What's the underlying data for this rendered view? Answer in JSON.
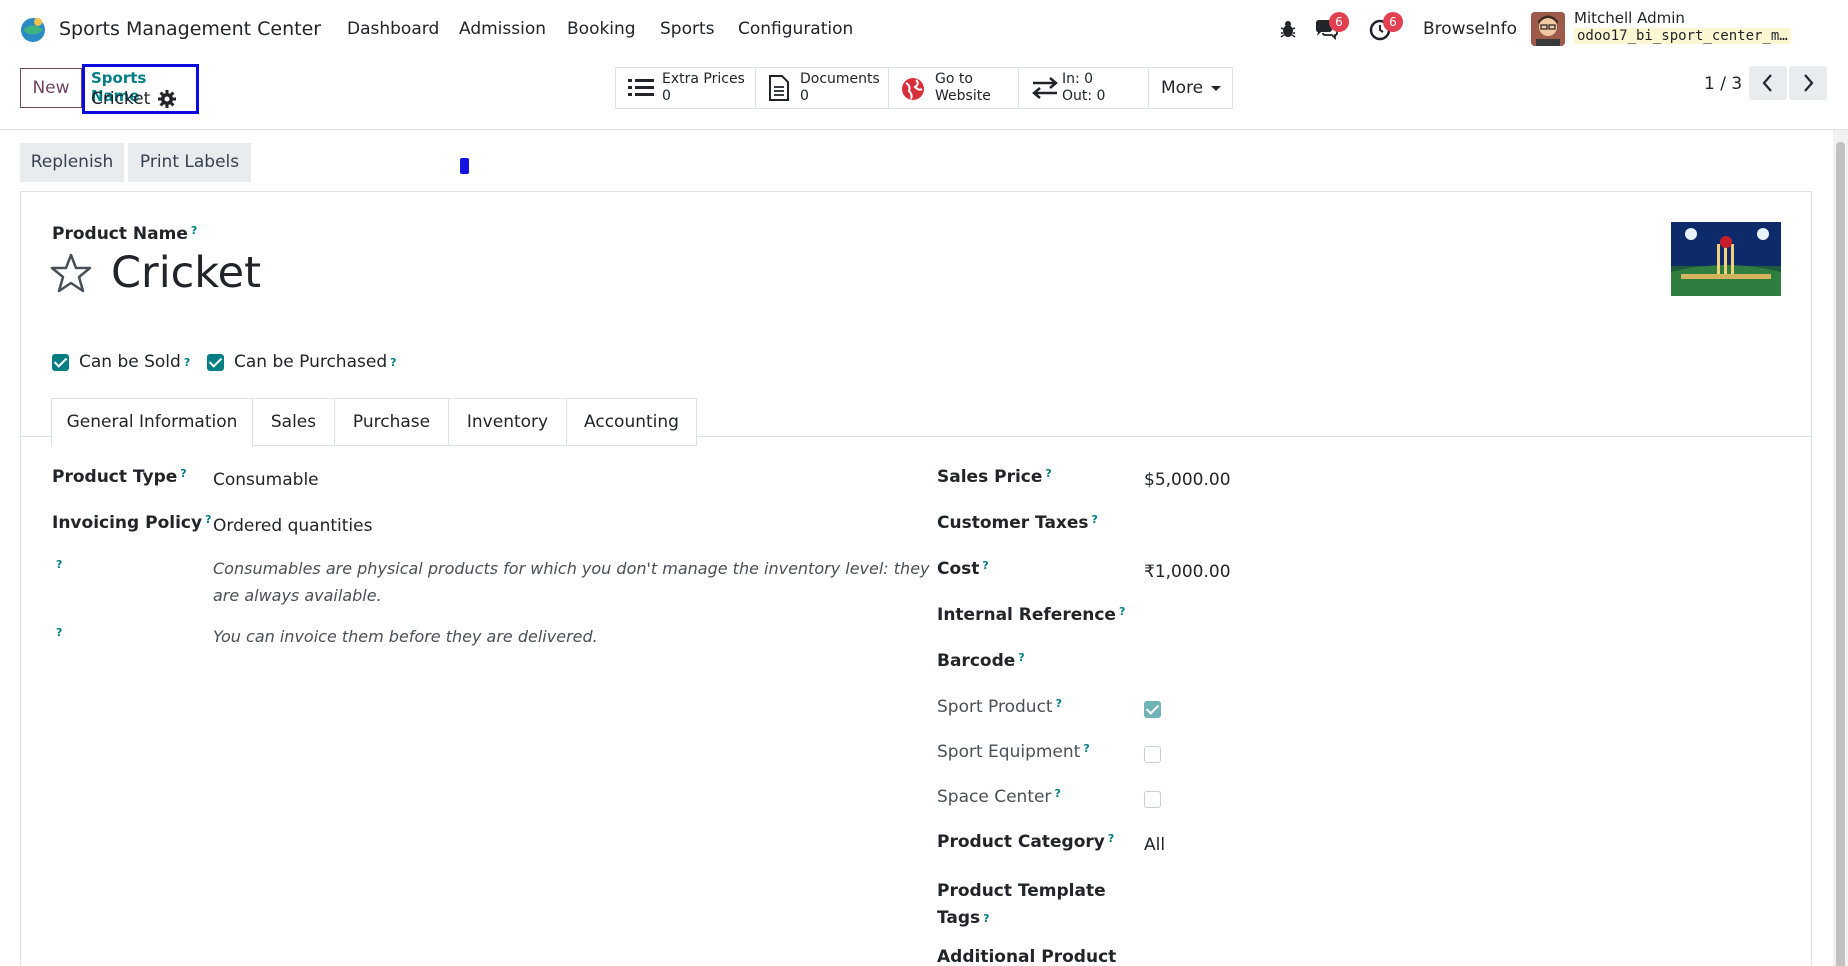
{
  "navbar": {
    "app_title": "Sports Management Center",
    "menu": [
      "Dashboard",
      "Admission",
      "Booking",
      "Sports",
      "Configuration"
    ],
    "messages_count": "6",
    "activities_count": "6",
    "company": "BrowseInfo",
    "user_name": "Mitchell Admin",
    "database": "odoo17_bi_sport_center_m…"
  },
  "control": {
    "new_label": "New",
    "breadcrumb_parent": "Sports Name",
    "breadcrumb_current": "Cricket",
    "smart_buttons": [
      {
        "label": "Extra Prices",
        "value": "0"
      },
      {
        "label": "Documents",
        "value": "0"
      },
      {
        "label": "Go to",
        "value": "Website"
      },
      {
        "label": "In: 0",
        "value": "Out: 0"
      }
    ],
    "more_label": "More",
    "pager": "1 / 3"
  },
  "status_buttons": [
    "Replenish",
    "Print Labels"
  ],
  "form": {
    "product_name_label": "Product Name",
    "product_name": "Cricket",
    "can_be_sold": "Can be Sold",
    "can_be_purchased": "Can be Purchased",
    "tabs": [
      "General Information",
      "Sales",
      "Purchase",
      "Inventory",
      "Accounting"
    ],
    "left": {
      "product_type_label": "Product Type",
      "product_type": "Consumable",
      "invoicing_policy_label": "Invoicing Policy",
      "invoicing_policy": "Ordered quantities",
      "help_1_line1": "Consumables are physical products for which you don't manage the inventory level: they",
      "help_1_line2": "are always available.",
      "help_2": "You can invoice them before they are delivered."
    },
    "right": {
      "sales_price_label": "Sales Price",
      "sales_price": "$5,000.00",
      "customer_taxes_label": "Customer Taxes",
      "cost_label": "Cost",
      "cost": "₹1,000.00",
      "internal_reference_label": "Internal Reference",
      "barcode_label": "Barcode",
      "sport_product_label": "Sport Product",
      "sport_product_checked": true,
      "sport_equipment_label": "Sport Equipment",
      "space_center_label": "Space Center",
      "product_category_label": "Product Category",
      "product_category": "All",
      "tags_label_line1": "Product Template",
      "tags_label_line2": "Tags",
      "additional_label": "Additional Product"
    }
  },
  "help_marker": "?",
  "colors": {
    "primary": "#71445f",
    "teal": "#017e84",
    "highlight_box": "#0b0be0",
    "badge": "#e0404f"
  },
  "icons": [
    "app-logo-icon",
    "bug-icon",
    "chat-icon",
    "clock-icon",
    "gear-icon",
    "list-icon",
    "document-icon",
    "globe-icon",
    "transfer-icon",
    "star-icon",
    "chevron-left-icon",
    "chevron-right-icon"
  ]
}
